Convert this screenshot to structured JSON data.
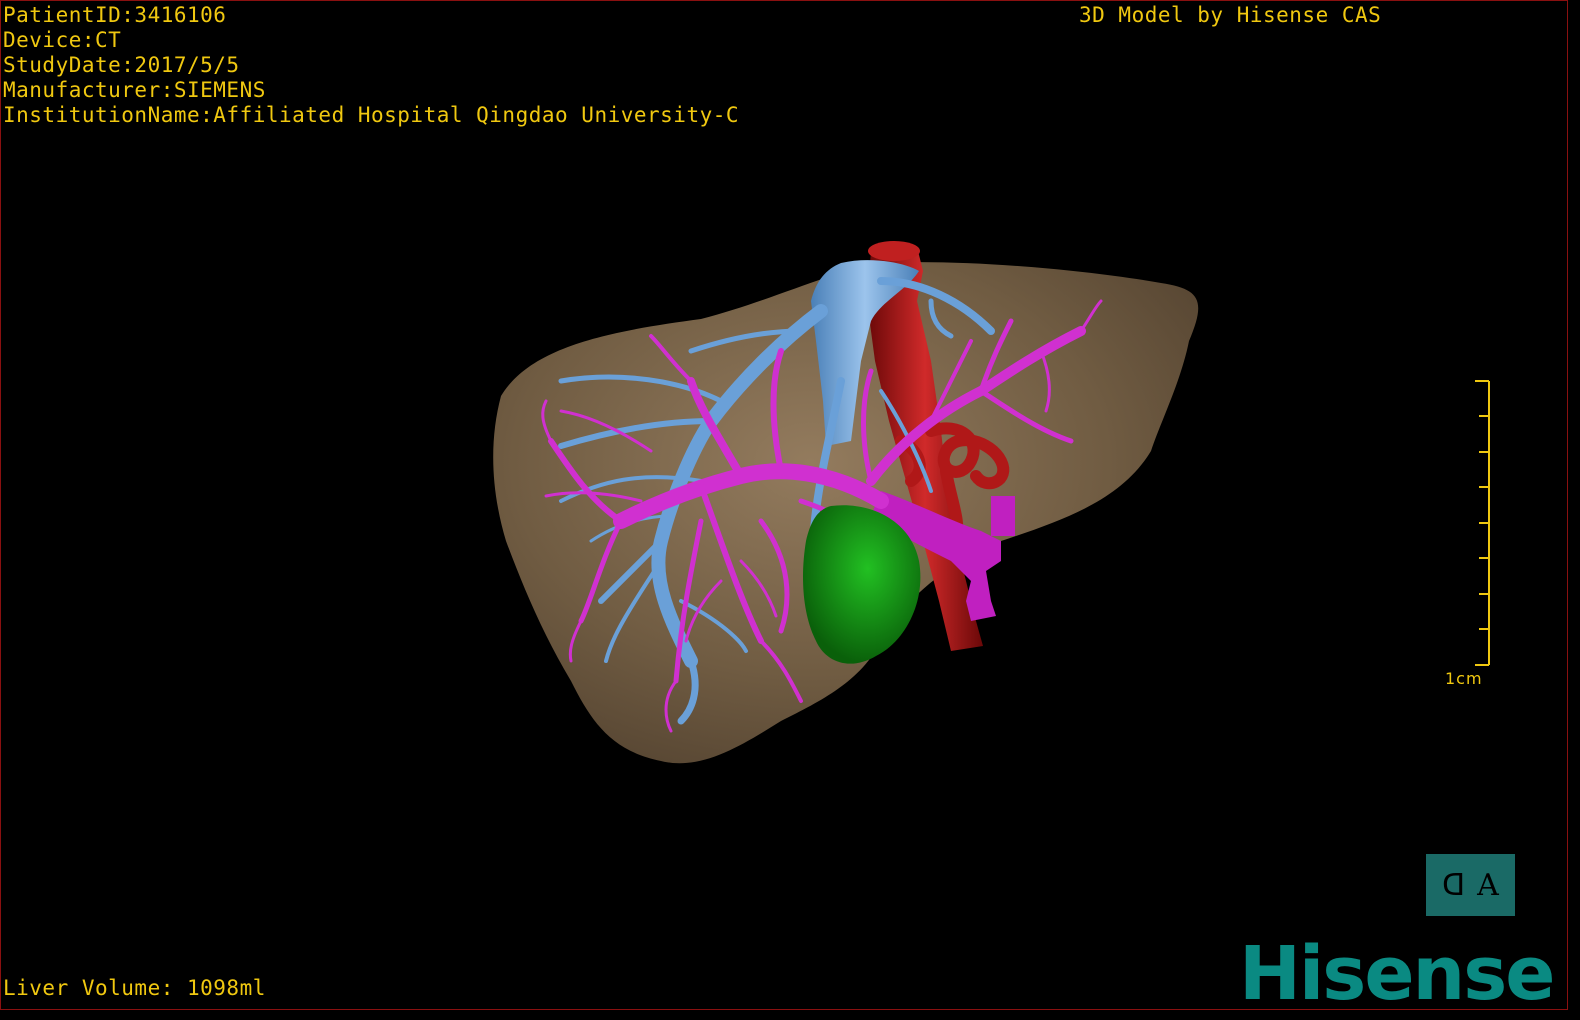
{
  "header": {
    "patient_id": "PatientID:3416106",
    "device": "Device:CT",
    "study_date": "StudyDate:2017/5/5",
    "manufacturer": "Manufacturer:SIEMENS",
    "institution": "InstitutionName:Affiliated Hospital Qingdao University-C",
    "credit": "3D Model by Hisense CAS"
  },
  "footer": {
    "liver_volume": "Liver Volume: 1098ml"
  },
  "scale": {
    "label": "1cm"
  },
  "orientation": {
    "left_glyph": "ᗡ",
    "right_glyph": "A"
  },
  "brand": {
    "name": "Hisense"
  },
  "colors": {
    "overlay_text": "#f0c810",
    "liver": "#8b7355",
    "portal_vein": "#d030d0",
    "hepatic_vein": "#6aa0d8",
    "artery": "#b01818",
    "gallbladder_or_tumor": "#12a012",
    "orientation_cube": "#1a6a66",
    "brand": "#0a8a82"
  },
  "icons": {
    "orientation_cube": "orientation-cube-icon",
    "scale_bar": "scale-bar-icon"
  }
}
